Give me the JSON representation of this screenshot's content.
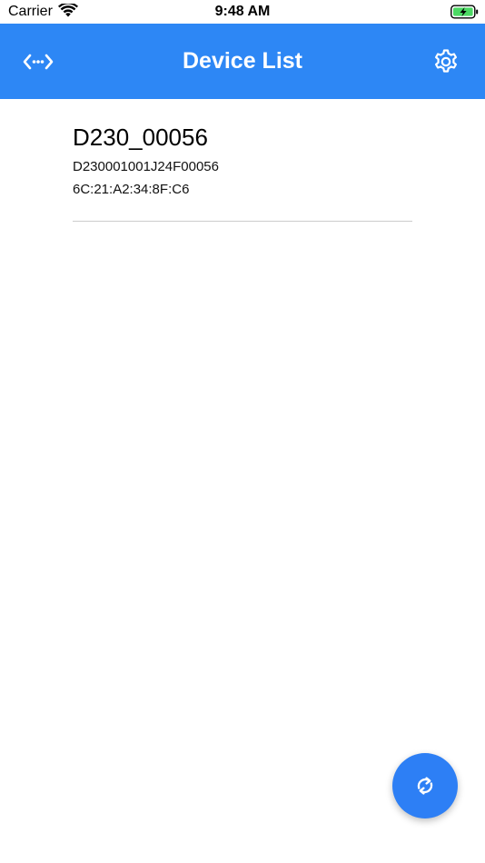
{
  "status_bar": {
    "carrier": "Carrier",
    "time": "9:48 AM",
    "wifi_icon": "wifi-icon",
    "battery_icon": "battery-charging-icon"
  },
  "header": {
    "title": "Device List",
    "left_icon": "code-arrows-icon",
    "right_icon": "gear-icon",
    "background_color": "#2d87f5"
  },
  "devices": [
    {
      "name": "D230_00056",
      "serial": "D230001001J24F00056",
      "mac": "6C:21:A2:34:8F:C6"
    }
  ],
  "fab": {
    "icon": "refresh-icon",
    "color": "#2d7ff5"
  }
}
